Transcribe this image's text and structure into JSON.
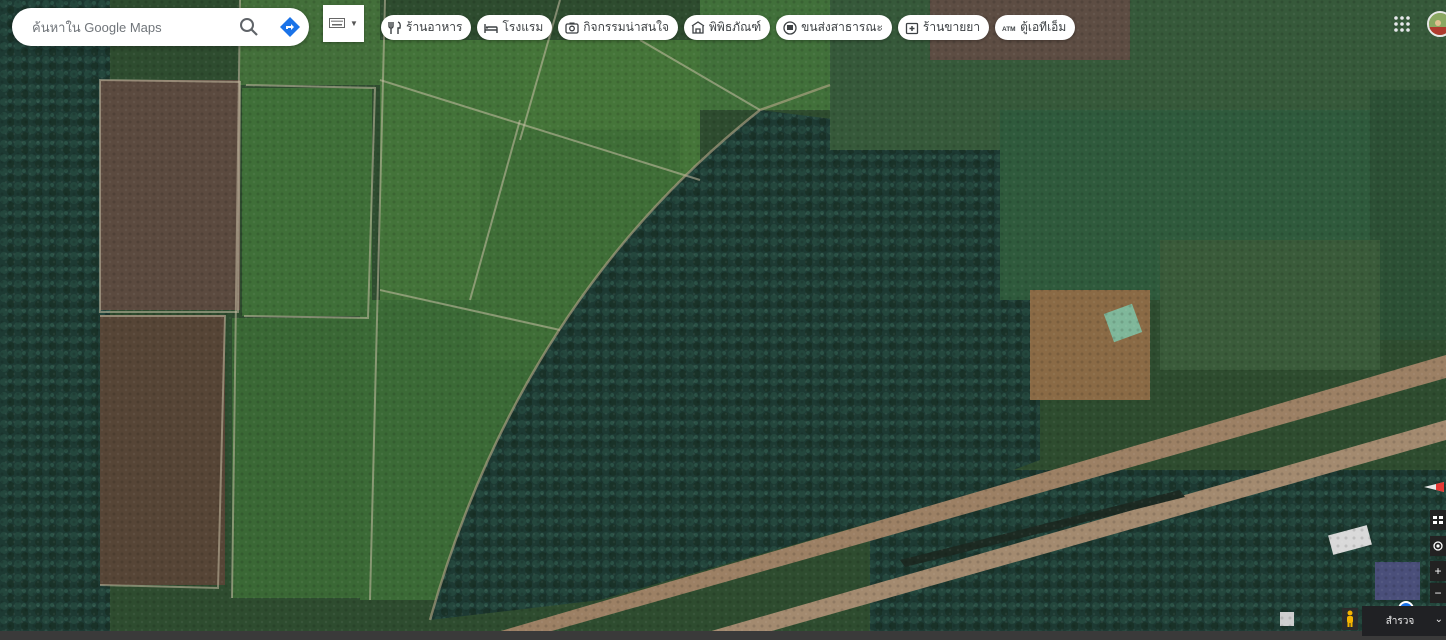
{
  "search": {
    "placeholder": "ค้นหาใน Google Maps"
  },
  "categories": [
    {
      "label": "ร้านอาหาร",
      "icon": "fork-knife-icon"
    },
    {
      "label": "โรงแรม",
      "icon": "bed-icon"
    },
    {
      "label": "กิจกรรมน่าสนใจ",
      "icon": "camera-icon"
    },
    {
      "label": "พิพิธภัณฑ์",
      "icon": "museum-icon"
    },
    {
      "label": "ขนส่งสาธารณะ",
      "icon": "bus-icon"
    },
    {
      "label": "ร้านขายยา",
      "icon": "pharmacy-icon"
    },
    {
      "label": "ตู้เอทีเอ็ม",
      "icon": "atm-icon"
    }
  ],
  "explore": {
    "label": "สำรวจ"
  },
  "colors": {
    "field_green": "#3d6b33",
    "field_brown": "#5a4a3a",
    "forest": "#1f3b2d",
    "road": "#a88b6a",
    "accent_blue": "#1a73e8"
  }
}
